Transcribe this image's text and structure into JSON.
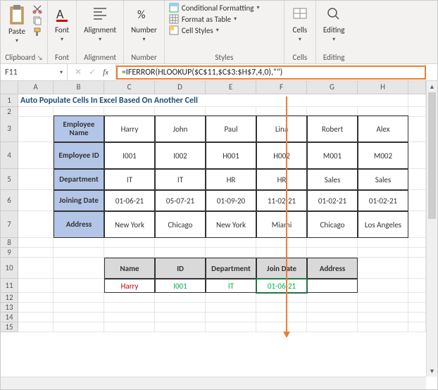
{
  "ribbon": {
    "clipboard": {
      "label": "Clipboard",
      "paste": "Paste"
    },
    "font": {
      "label": "Font",
      "btn": "Font"
    },
    "alignment": {
      "label": "Alignment",
      "btn": "Alignment"
    },
    "number": {
      "label": "Number",
      "btn": "Number"
    },
    "styles": {
      "label": "Styles",
      "cond_fmt": "Conditional Formatting",
      "fmt_table": "Format as Table",
      "cell_styles": "Cell Styles"
    },
    "cells": {
      "label": "Cells",
      "btn": "Cells"
    },
    "editing": {
      "label": "Editing",
      "btn": "Editing"
    }
  },
  "formula_bar": {
    "name_box": "F11",
    "formula": "=IFERROR(HLOOKUP($C$11,$C$3:$H$7,4,0),\"\")"
  },
  "columns": [
    "",
    "A",
    "B",
    "C",
    "D",
    "E",
    "F",
    "G",
    "H",
    ""
  ],
  "title": "Auto Populate Cells In Excel Based On Another Cell",
  "table1": {
    "row_labels": [
      "Employee Name",
      "Employee ID",
      "Department",
      "Joining Date",
      "Address"
    ],
    "data": [
      [
        "Harry",
        "John",
        "Paul",
        "Lina",
        "Robert",
        "Alex"
      ],
      [
        "I001",
        "I002",
        "H001",
        "H002",
        "M001",
        "M002"
      ],
      [
        "IT",
        "IT",
        "HR",
        "HR",
        "Sales",
        "Sales"
      ],
      [
        "01-06-21",
        "05-07-21",
        "01-09-20",
        "11-02-21",
        "01-02-21",
        "01-02-21"
      ],
      [
        "New York",
        "Chicago",
        "New York",
        "Miami",
        "Chicago",
        "Los Angeles"
      ]
    ]
  },
  "table2": {
    "headers": [
      "Name",
      "ID",
      "Department",
      "Join Date",
      "Address"
    ],
    "values": [
      "Harry",
      "I001",
      "IT",
      "01-06-21",
      ""
    ]
  },
  "row_numbers": [
    "1",
    "2",
    "3",
    "4",
    "5",
    "6",
    "7",
    "8",
    "9",
    "10",
    "11",
    "12",
    "13",
    "14",
    "15"
  ]
}
